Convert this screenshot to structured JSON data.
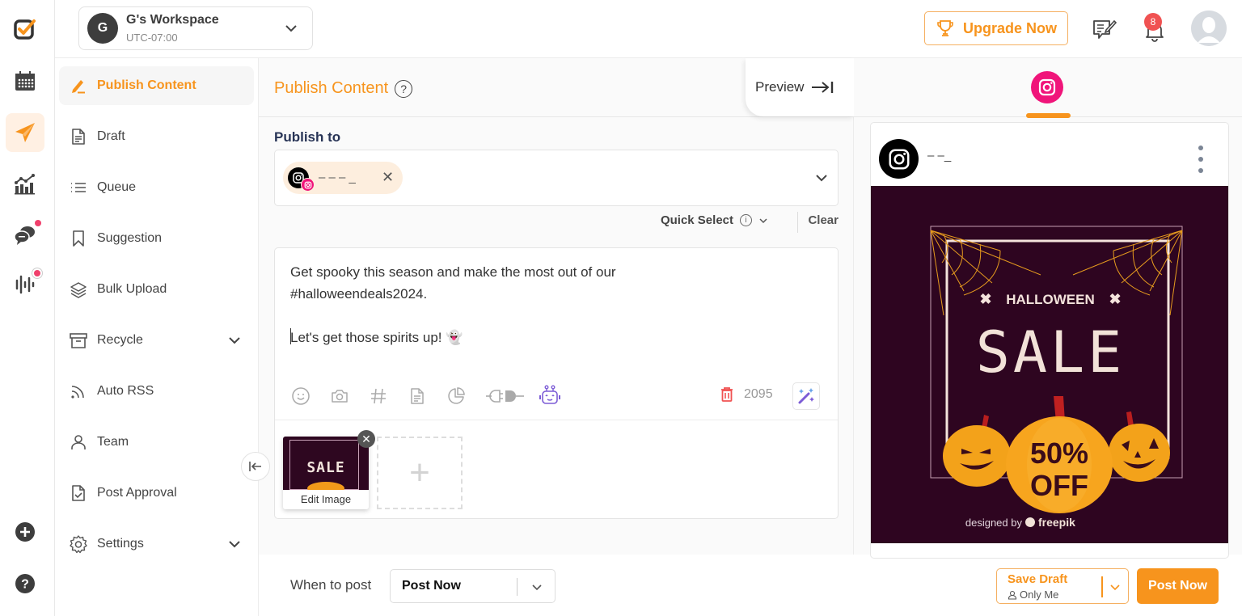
{
  "rail": {
    "items": [
      {
        "name": "logo",
        "icon": "logo-check-icon"
      },
      {
        "name": "calendar",
        "icon": "calendar-icon"
      },
      {
        "name": "publish",
        "icon": "paper-plane-icon",
        "active": true
      },
      {
        "name": "analytics",
        "icon": "analytics-chart-icon"
      },
      {
        "name": "inbox",
        "icon": "chat-bubbles-icon",
        "has_dot": true
      },
      {
        "name": "listening",
        "icon": "sound-wave-icon",
        "has_dot": true
      }
    ],
    "bottom": [
      {
        "name": "add",
        "icon": "plus-circle-icon"
      },
      {
        "name": "help",
        "icon": "help-circle-icon"
      }
    ]
  },
  "topbar": {
    "workspace": {
      "initial": "G",
      "name": "G's Workspace",
      "timezone": "UTC-07:00"
    },
    "upgrade_label": "Upgrade Now",
    "notification_count": "8"
  },
  "menu": {
    "items": [
      {
        "label": "Publish Content",
        "icon": "pencil-icon",
        "active": true
      },
      {
        "label": "Draft",
        "icon": "document-icon"
      },
      {
        "label": "Queue",
        "icon": "list-icon"
      },
      {
        "label": "Suggestion",
        "icon": "bookmark-icon"
      },
      {
        "label": "Bulk Upload",
        "icon": "layers-icon"
      },
      {
        "label": "Recycle",
        "icon": "archive-box-icon",
        "expandable": true
      },
      {
        "label": "Auto RSS",
        "icon": "rss-icon"
      },
      {
        "label": "Team",
        "icon": "user-icon"
      },
      {
        "label": "Post Approval",
        "icon": "file-check-icon"
      },
      {
        "label": "Settings",
        "icon": "gear-icon",
        "expandable": true
      }
    ]
  },
  "editor": {
    "title": "Publish Content",
    "help_glyph": "?",
    "preview_label": "Preview",
    "publish_to_label": "Publish to",
    "selected_account": {
      "name": "‒ ‒ ‒ _",
      "network": "instagram"
    },
    "quick_select_label": "Quick Select",
    "clear_label": "Clear",
    "content": {
      "line1": "Get spooky this season and make the most out of our",
      "line2": "#halloweendeals2024.",
      "line3": "",
      "line4": "Let's get those spirits up! 👻"
    },
    "char_count": "2095",
    "tools": [
      "emoji-icon",
      "camera-icon",
      "hashtag-icon",
      "document-icon",
      "pie-chart-icon",
      "plug-icon",
      "ai-robot-icon"
    ],
    "media": {
      "thumb_text": "SALE",
      "edit_label": "Edit Image",
      "add_glyph": "+"
    }
  },
  "bottom": {
    "when_label": "When to post",
    "when_value": "Post Now",
    "save_draft_label": "Save Draft",
    "save_draft_visibility": "Only Me",
    "post_now_label": "Post Now"
  },
  "preview": {
    "active_network": "instagram",
    "username": "‒  ‒_",
    "image": {
      "headline": "HALLOWEEN",
      "title": "SALE",
      "offer_line1": "50%",
      "offer_line2": "OFF",
      "credit_prefix": "designed by",
      "credit_brand": "freepik"
    }
  },
  "colors": {
    "accent": "#f7941d",
    "instagram": "#f0157a",
    "ai_purple": "#7c5cd6",
    "danger": "#f05252"
  }
}
